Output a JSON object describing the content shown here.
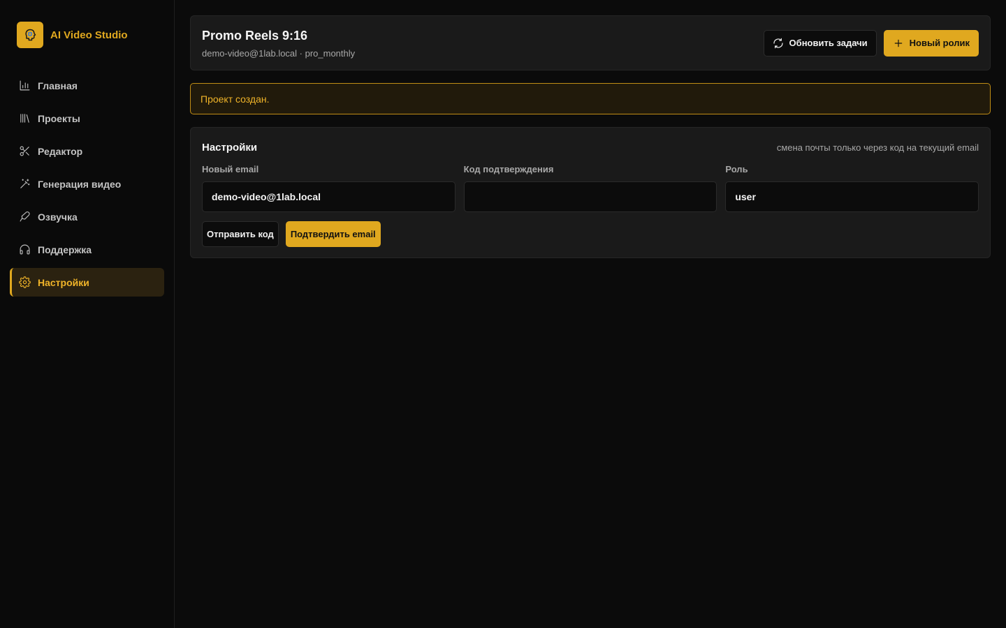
{
  "brand": {
    "title": "AI Video Studio",
    "logo_icon": "brain-icon"
  },
  "sidebar": {
    "items": [
      {
        "label": "Главная",
        "icon": "bar-chart-icon",
        "active": false
      },
      {
        "label": "Проекты",
        "icon": "library-icon",
        "active": false
      },
      {
        "label": "Редактор",
        "icon": "scissors-icon",
        "active": false
      },
      {
        "label": "Генерация видео",
        "icon": "magic-wand-icon",
        "active": false
      },
      {
        "label": "Озвучка",
        "icon": "mic-icon",
        "active": false
      },
      {
        "label": "Поддержка",
        "icon": "headphones-icon",
        "active": false
      },
      {
        "label": "Настройки",
        "icon": "gear-icon",
        "active": true
      }
    ]
  },
  "header": {
    "title": "Promo Reels 9:16",
    "subtitle": "demo-video@1lab.local · pro_monthly",
    "refresh_label": "Обновить задачи",
    "new_label": "Новый ролик"
  },
  "alert": {
    "text": "Проект создан."
  },
  "settings": {
    "title": "Настройки",
    "note": "смена почты только через код на текущий email",
    "email_label": "Новый email",
    "email_value": "demo-video@1lab.local",
    "code_label": "Код подтверждения",
    "code_value": "",
    "role_label": "Роль",
    "role_value": "user",
    "send_code_label": "Отправить код",
    "confirm_label": "Подтвердить email"
  },
  "colors": {
    "accent": "#e0a81f",
    "background": "#0b0b0b",
    "card": "#1a1a1a",
    "alert_bg": "#211a0b"
  }
}
